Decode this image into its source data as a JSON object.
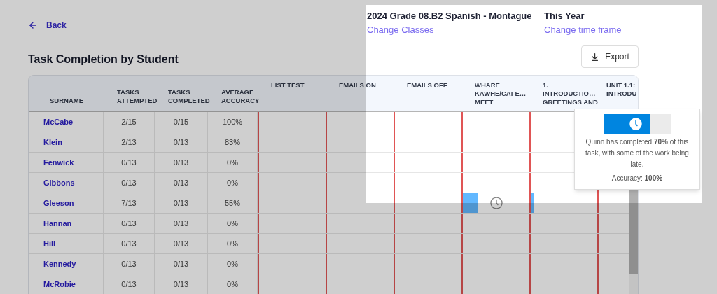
{
  "back_link": "Back",
  "page_title": "Task Completion by Student",
  "class_info": {
    "name": "2024 Grade 08.B2 Spanish - Montague",
    "change_link": "Change Classes"
  },
  "time_frame": {
    "name": "This Year",
    "change_link": "Change time frame"
  },
  "export_button": "Export",
  "table": {
    "columns": [
      {
        "kind": "name",
        "lines": [
          "SURNAME"
        ]
      },
      {
        "kind": "stat",
        "lines": [
          "TASKS",
          "ATTEMPTED"
        ]
      },
      {
        "kind": "stat",
        "lines": [
          "TASKS",
          "COMPLETED"
        ]
      },
      {
        "kind": "stat",
        "lines": [
          "AVERAGE",
          "ACCURACY"
        ]
      },
      {
        "kind": "task",
        "lines": [
          "LIST TEST"
        ]
      },
      {
        "kind": "task",
        "lines": [
          "EMAILS ON"
        ]
      },
      {
        "kind": "task",
        "lines": [
          "EMAILS OFF"
        ]
      },
      {
        "kind": "task",
        "lines": [
          "WHARE",
          "KAWHE/CAFE…",
          "MEET"
        ]
      },
      {
        "kind": "task",
        "lines": [
          "1.",
          "INTRODUCTIO…",
          "GREETINGS AND"
        ]
      },
      {
        "kind": "task",
        "lines": [
          "UNIT 1.1:",
          "INTRODU"
        ]
      }
    ],
    "rows": [
      {
        "surname": "McCabe",
        "attempted": "2/15",
        "completed": "0/15",
        "accuracy": "100%"
      },
      {
        "surname": "Klein",
        "attempted": "2/13",
        "completed": "0/13",
        "accuracy": "83%"
      },
      {
        "surname": "Fenwick",
        "attempted": "0/13",
        "completed": "0/13",
        "accuracy": "0%"
      },
      {
        "surname": "Gibbons",
        "attempted": "0/13",
        "completed": "0/13",
        "accuracy": "0%"
      },
      {
        "surname": "Gleeson",
        "attempted": "7/13",
        "completed": "0/13",
        "accuracy": "55%",
        "task_progress": [
          {
            "kind": "empty"
          },
          {
            "kind": "empty"
          },
          {
            "kind": "empty"
          },
          {
            "kind": "partial",
            "level": 0.22,
            "late": true
          },
          {
            "kind": "partial",
            "level": 0.05,
            "late": false
          },
          {
            "kind": "empty"
          }
        ]
      },
      {
        "surname": "Hannan",
        "attempted": "0/13",
        "completed": "0/13",
        "accuracy": "0%"
      },
      {
        "surname": "Hill",
        "attempted": "0/13",
        "completed": "0/13",
        "accuracy": "0%"
      },
      {
        "surname": "Kennedy",
        "attempted": "0/13",
        "completed": "0/13",
        "accuracy": "0%"
      },
      {
        "surname": "McRobie",
        "attempted": "0/13",
        "completed": "0/13",
        "accuracy": "0%"
      }
    ]
  },
  "tooltip": {
    "level": 0.7,
    "late": true,
    "message": "Quinn has completed **70%** of this task, with some of the work being late.",
    "accuracy": "Accuracy: **100%**"
  }
}
